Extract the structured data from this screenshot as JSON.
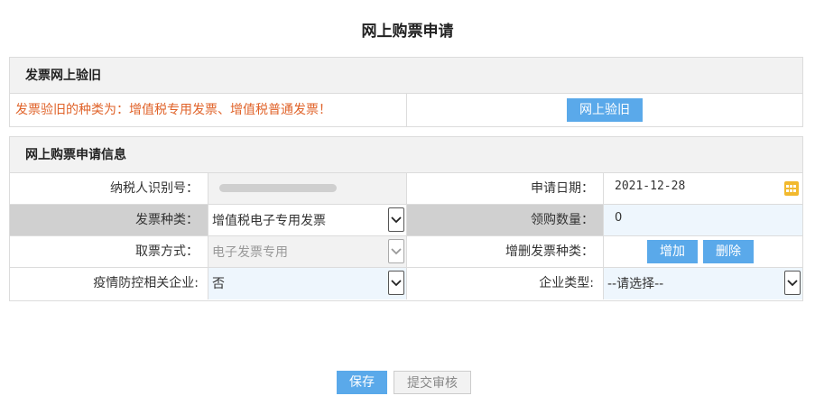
{
  "page": {
    "title": "网上购票申请"
  },
  "verify_panel": {
    "header": "发票网上验旧",
    "message": "发票验旧的种类为：增值税专用发票、增值税普通发票！",
    "button": "网上验旧"
  },
  "apply_panel": {
    "header": "网上购票申请信息",
    "taxpayer_id_label": "纳税人识别号：",
    "apply_date_label": "申请日期：",
    "apply_date_value": "2021-12-28",
    "invoice_type_label": "发票种类：",
    "invoice_type_value": "增值税电子专用发票",
    "quantity_label": "领购数量：",
    "quantity_value": "0",
    "pickup_label": "取票方式：",
    "pickup_value": "电子发票专用",
    "add_remove_label": "增删发票种类：",
    "add_button": "增加",
    "delete_button": "删除",
    "epidemic_label": "疫情防控相关企业:",
    "epidemic_value": "否",
    "company_type_label": "企业类型:",
    "company_type_value": "--请选择--"
  },
  "actions": {
    "save": "保存",
    "submit": "提交审核"
  },
  "colors": {
    "accent": "#5aa9ea",
    "warning_text": "#e0632a",
    "shaded_label": "#d0d0d0"
  }
}
